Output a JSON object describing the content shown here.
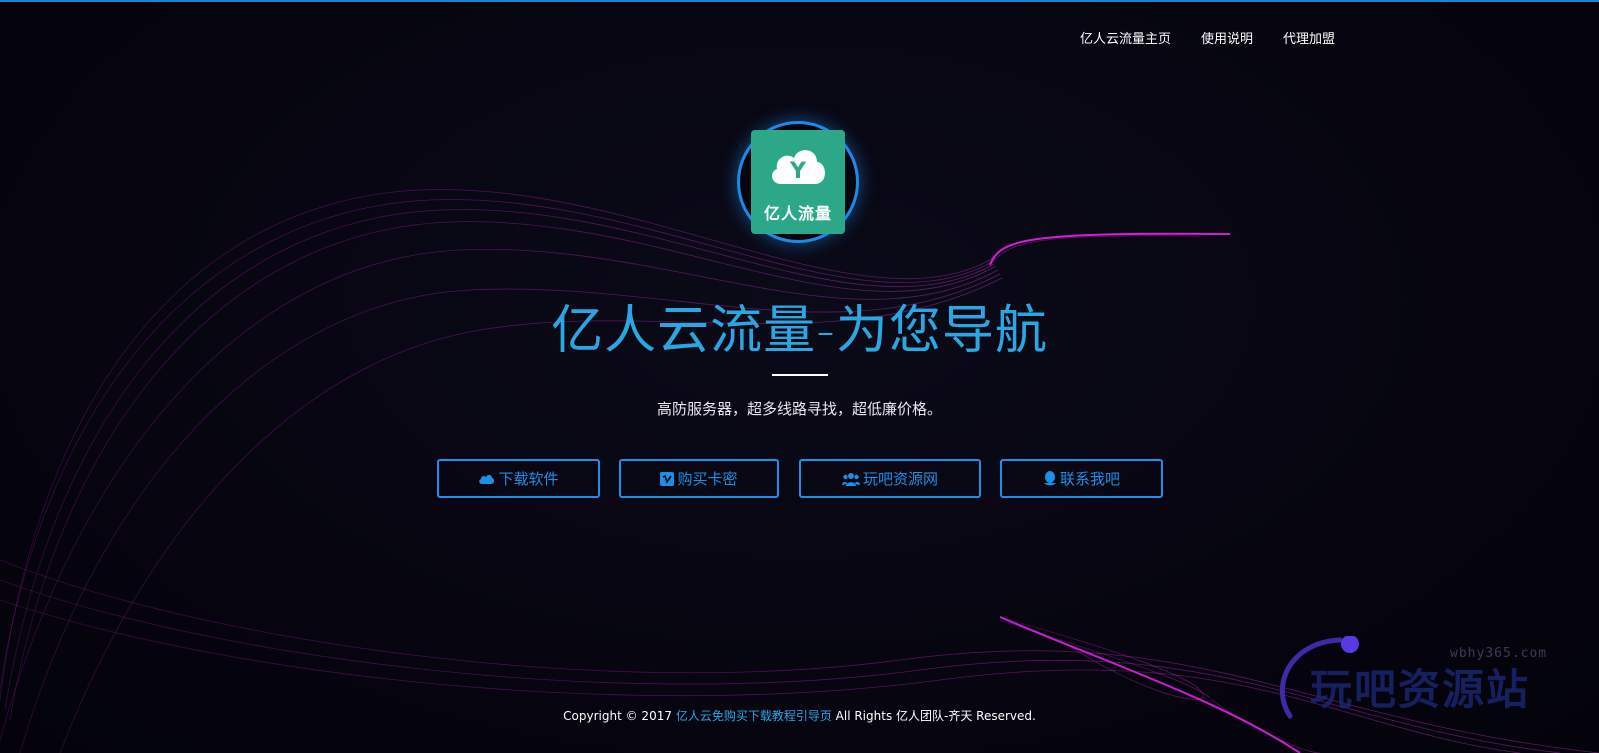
{
  "nav": {
    "items": [
      {
        "label": "亿人云流量主页"
      },
      {
        "label": "使用说明"
      },
      {
        "label": "代理加盟"
      }
    ]
  },
  "logo": {
    "text": "亿人流量",
    "letter": "Y"
  },
  "hero": {
    "title": "亿人云流量-为您导航",
    "tagline": "高防服务器，超多线路寻找，超低廉价格。"
  },
  "buttons": [
    {
      "label": "下载软件",
      "icon": "cloud-icon"
    },
    {
      "label": "购买卡密",
      "icon": "vimeo-icon"
    },
    {
      "label": "玩吧资源网",
      "icon": "users-icon"
    },
    {
      "label": "联系我吧",
      "icon": "qq-icon"
    }
  ],
  "footer": {
    "prefix": "Copyright © 2017",
    "link": "亿人云免购买下载教程引导页",
    "suffix": "All Rights 亿人团队-齐天 Reserved."
  },
  "watermark": {
    "url": "wbhy365.com",
    "brand": "玩吧资源站"
  },
  "colors": {
    "accent": "#1c8fe6",
    "title": "#2aa6e0",
    "swirl": "#e020e0",
    "background": "#07060f"
  }
}
